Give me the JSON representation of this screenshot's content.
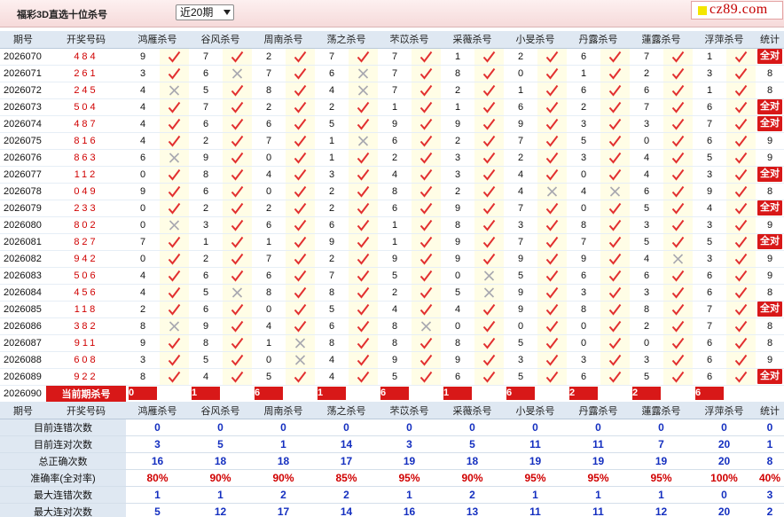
{
  "header": {
    "title": "福彩3D直选十位杀号",
    "period_select": "近20期",
    "logo_text": "cz89.com"
  },
  "columns": {
    "issue": "期号",
    "numbers": "开奖号码",
    "experts": [
      "鸿雁杀号",
      "谷风杀号",
      "周南杀号",
      "荡之杀号",
      "芣苡杀号",
      "采薇杀号",
      "小旻杀号",
      "丹露杀号",
      "蓮露杀号",
      "浮萍杀号"
    ],
    "stat": "统计"
  },
  "rows": [
    {
      "issue": "2026070",
      "numbers": "484",
      "kills": [
        [
          9,
          1
        ],
        [
          7,
          1
        ],
        [
          2,
          1
        ],
        [
          7,
          1
        ],
        [
          7,
          1
        ],
        [
          1,
          1
        ],
        [
          2,
          1
        ],
        [
          6,
          1
        ],
        [
          7,
          1
        ],
        [
          1,
          1
        ]
      ],
      "stat": "全对"
    },
    {
      "issue": "2026071",
      "numbers": "261",
      "kills": [
        [
          3,
          1
        ],
        [
          6,
          0
        ],
        [
          7,
          1
        ],
        [
          6,
          0
        ],
        [
          7,
          1
        ],
        [
          8,
          1
        ],
        [
          0,
          1
        ],
        [
          1,
          1
        ],
        [
          2,
          1
        ],
        [
          3,
          1
        ]
      ],
      "stat": "8"
    },
    {
      "issue": "2026072",
      "numbers": "245",
      "kills": [
        [
          4,
          0
        ],
        [
          5,
          1
        ],
        [
          8,
          1
        ],
        [
          4,
          0
        ],
        [
          7,
          1
        ],
        [
          2,
          1
        ],
        [
          1,
          1
        ],
        [
          6,
          1
        ],
        [
          6,
          1
        ],
        [
          1,
          1
        ]
      ],
      "stat": "8"
    },
    {
      "issue": "2026073",
      "numbers": "504",
      "kills": [
        [
          4,
          1
        ],
        [
          7,
          1
        ],
        [
          2,
          1
        ],
        [
          2,
          1
        ],
        [
          1,
          1
        ],
        [
          1,
          1
        ],
        [
          6,
          1
        ],
        [
          2,
          1
        ],
        [
          7,
          1
        ],
        [
          6,
          1
        ]
      ],
      "stat": "全对"
    },
    {
      "issue": "2026074",
      "numbers": "487",
      "kills": [
        [
          4,
          1
        ],
        [
          6,
          1
        ],
        [
          6,
          1
        ],
        [
          5,
          1
        ],
        [
          9,
          1
        ],
        [
          9,
          1
        ],
        [
          9,
          1
        ],
        [
          3,
          1
        ],
        [
          3,
          1
        ],
        [
          7,
          1
        ]
      ],
      "stat": "全对"
    },
    {
      "issue": "2026075",
      "numbers": "816",
      "kills": [
        [
          4,
          1
        ],
        [
          2,
          1
        ],
        [
          7,
          1
        ],
        [
          1,
          0
        ],
        [
          6,
          1
        ],
        [
          2,
          1
        ],
        [
          7,
          1
        ],
        [
          5,
          1
        ],
        [
          0,
          1
        ],
        [
          6,
          1
        ]
      ],
      "stat": "9"
    },
    {
      "issue": "2026076",
      "numbers": "863",
      "kills": [
        [
          6,
          0
        ],
        [
          9,
          1
        ],
        [
          0,
          1
        ],
        [
          1,
          1
        ],
        [
          2,
          1
        ],
        [
          3,
          1
        ],
        [
          2,
          1
        ],
        [
          3,
          1
        ],
        [
          4,
          1
        ],
        [
          5,
          1
        ]
      ],
      "stat": "9"
    },
    {
      "issue": "2026077",
      "numbers": "112",
      "kills": [
        [
          0,
          1
        ],
        [
          8,
          1
        ],
        [
          4,
          1
        ],
        [
          3,
          1
        ],
        [
          4,
          1
        ],
        [
          3,
          1
        ],
        [
          4,
          1
        ],
        [
          0,
          1
        ],
        [
          4,
          1
        ],
        [
          3,
          1
        ]
      ],
      "stat": "全对"
    },
    {
      "issue": "2026078",
      "numbers": "049",
      "kills": [
        [
          9,
          1
        ],
        [
          6,
          1
        ],
        [
          0,
          1
        ],
        [
          2,
          1
        ],
        [
          8,
          1
        ],
        [
          2,
          1
        ],
        [
          4,
          0
        ],
        [
          4,
          0
        ],
        [
          6,
          1
        ],
        [
          9,
          1
        ]
      ],
      "stat": "8"
    },
    {
      "issue": "2026079",
      "numbers": "233",
      "kills": [
        [
          0,
          1
        ],
        [
          2,
          1
        ],
        [
          2,
          1
        ],
        [
          2,
          1
        ],
        [
          6,
          1
        ],
        [
          9,
          1
        ],
        [
          7,
          1
        ],
        [
          0,
          1
        ],
        [
          5,
          1
        ],
        [
          4,
          1
        ]
      ],
      "stat": "全对"
    },
    {
      "issue": "2026080",
      "numbers": "802",
      "kills": [
        [
          0,
          0
        ],
        [
          3,
          1
        ],
        [
          6,
          1
        ],
        [
          6,
          1
        ],
        [
          1,
          1
        ],
        [
          8,
          1
        ],
        [
          3,
          1
        ],
        [
          8,
          1
        ],
        [
          3,
          1
        ],
        [
          3,
          1
        ]
      ],
      "stat": "9"
    },
    {
      "issue": "2026081",
      "numbers": "827",
      "kills": [
        [
          7,
          1
        ],
        [
          1,
          1
        ],
        [
          1,
          1
        ],
        [
          9,
          1
        ],
        [
          1,
          1
        ],
        [
          9,
          1
        ],
        [
          7,
          1
        ],
        [
          7,
          1
        ],
        [
          5,
          1
        ],
        [
          5,
          1
        ]
      ],
      "stat": "全对"
    },
    {
      "issue": "2026082",
      "numbers": "942",
      "kills": [
        [
          0,
          1
        ],
        [
          2,
          1
        ],
        [
          7,
          1
        ],
        [
          2,
          1
        ],
        [
          9,
          1
        ],
        [
          9,
          1
        ],
        [
          9,
          1
        ],
        [
          9,
          1
        ],
        [
          4,
          0
        ],
        [
          3,
          1
        ]
      ],
      "stat": "9"
    },
    {
      "issue": "2026083",
      "numbers": "506",
      "kills": [
        [
          4,
          1
        ],
        [
          6,
          1
        ],
        [
          6,
          1
        ],
        [
          7,
          1
        ],
        [
          5,
          1
        ],
        [
          0,
          0
        ],
        [
          5,
          1
        ],
        [
          6,
          1
        ],
        [
          6,
          1
        ],
        [
          6,
          1
        ]
      ],
      "stat": "9"
    },
    {
      "issue": "2026084",
      "numbers": "456",
      "kills": [
        [
          4,
          1
        ],
        [
          5,
          0
        ],
        [
          8,
          1
        ],
        [
          8,
          1
        ],
        [
          2,
          1
        ],
        [
          5,
          0
        ],
        [
          9,
          1
        ],
        [
          3,
          1
        ],
        [
          3,
          1
        ],
        [
          6,
          1
        ]
      ],
      "stat": "8"
    },
    {
      "issue": "2026085",
      "numbers": "118",
      "kills": [
        [
          2,
          1
        ],
        [
          6,
          1
        ],
        [
          0,
          1
        ],
        [
          5,
          1
        ],
        [
          4,
          1
        ],
        [
          4,
          1
        ],
        [
          9,
          1
        ],
        [
          8,
          1
        ],
        [
          8,
          1
        ],
        [
          7,
          1
        ]
      ],
      "stat": "全对"
    },
    {
      "issue": "2026086",
      "numbers": "382",
      "kills": [
        [
          8,
          0
        ],
        [
          9,
          1
        ],
        [
          4,
          1
        ],
        [
          6,
          1
        ],
        [
          8,
          0
        ],
        [
          0,
          1
        ],
        [
          0,
          1
        ],
        [
          0,
          1
        ],
        [
          2,
          1
        ],
        [
          7,
          1
        ]
      ],
      "stat": "8"
    },
    {
      "issue": "2026087",
      "numbers": "911",
      "kills": [
        [
          9,
          1
        ],
        [
          8,
          1
        ],
        [
          1,
          0
        ],
        [
          8,
          1
        ],
        [
          8,
          1
        ],
        [
          8,
          1
        ],
        [
          5,
          1
        ],
        [
          0,
          1
        ],
        [
          0,
          1
        ],
        [
          6,
          1
        ]
      ],
      "stat": "8"
    },
    {
      "issue": "2026088",
      "numbers": "608",
      "kills": [
        [
          3,
          1
        ],
        [
          5,
          1
        ],
        [
          0,
          0
        ],
        [
          4,
          1
        ],
        [
          9,
          1
        ],
        [
          9,
          1
        ],
        [
          3,
          1
        ],
        [
          3,
          1
        ],
        [
          3,
          1
        ],
        [
          6,
          1
        ]
      ],
      "stat": "9"
    },
    {
      "issue": "2026089",
      "numbers": "922",
      "kills": [
        [
          8,
          1
        ],
        [
          4,
          1
        ],
        [
          5,
          1
        ],
        [
          4,
          1
        ],
        [
          5,
          1
        ],
        [
          6,
          1
        ],
        [
          5,
          1
        ],
        [
          6,
          1
        ],
        [
          5,
          1
        ],
        [
          6,
          1
        ]
      ],
      "stat": "全对"
    }
  ],
  "current": {
    "issue": "2026090",
    "label": "当前期杀号",
    "kills": [
      "0",
      "1",
      "6",
      "1",
      "6",
      "1",
      "6",
      "2",
      "2",
      "6"
    ]
  },
  "summary": [
    {
      "label": "目前连错次数",
      "values": [
        "0",
        "0",
        "0",
        "0",
        "0",
        "0",
        "0",
        "0",
        "0",
        "0"
      ],
      "stat": "0",
      "red": false
    },
    {
      "label": "目前连对次数",
      "values": [
        "3",
        "5",
        "1",
        "14",
        "3",
        "5",
        "11",
        "11",
        "7",
        "20"
      ],
      "stat": "1",
      "red": false
    },
    {
      "label": "总正确次数",
      "values": [
        "16",
        "18",
        "18",
        "17",
        "19",
        "18",
        "19",
        "19",
        "19",
        "20"
      ],
      "stat": "8",
      "red": false
    },
    {
      "label": "准确率(全对率)",
      "values": [
        "80%",
        "90%",
        "90%",
        "85%",
        "95%",
        "90%",
        "95%",
        "95%",
        "95%",
        "100%"
      ],
      "stat": "40%",
      "red": true
    },
    {
      "label": "最大连错次数",
      "values": [
        "1",
        "1",
        "2",
        "2",
        "1",
        "2",
        "1",
        "1",
        "1",
        "0"
      ],
      "stat": "3",
      "red": false
    },
    {
      "label": "最大连对次数",
      "values": [
        "5",
        "12",
        "17",
        "14",
        "16",
        "13",
        "11",
        "11",
        "12",
        "20"
      ],
      "stat": "2",
      "red": false
    }
  ]
}
